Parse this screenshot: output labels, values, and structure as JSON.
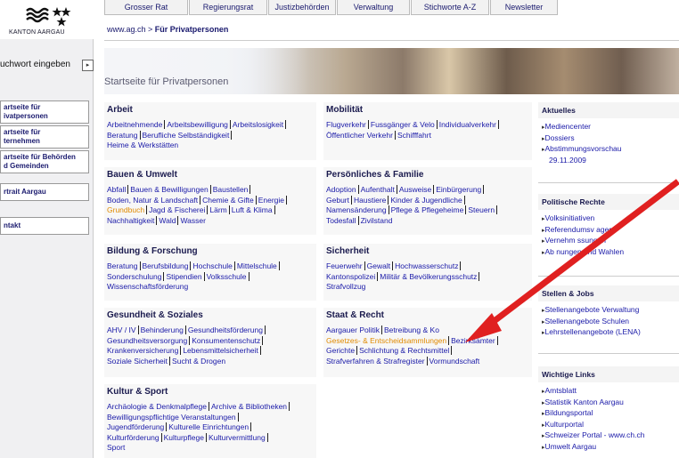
{
  "logo_text": "KANTON AARGAU",
  "topnav": [
    "Grosser Rat",
    "Regierungsrat",
    "Justizbehörden",
    "Verwaltung",
    "Stichworte A-Z",
    "Newsletter"
  ],
  "breadcrumb": {
    "site": "www.ag.ch",
    "sep": " > ",
    "page": "Für Privatpersonen"
  },
  "banner_title": "Startseite für Privatpersonen",
  "search": {
    "label": "uchwort eingeben",
    "button": "▸"
  },
  "leftnav": [
    {
      "line1": "artseite für",
      "line2": "ivatpersonen"
    },
    {
      "line1": "artseite für",
      "line2": "ternehmen"
    },
    {
      "line1": "artseite für Behörden",
      "line2": "d Gemeinden"
    },
    {
      "line1": "rtrait Aargau",
      "line2": ""
    },
    {
      "line1": "ntakt",
      "line2": ""
    }
  ],
  "sections": {
    "arbeit": {
      "title": "Arbeit",
      "links": [
        "Arbeitnehmende",
        "Arbeitsbewilligung",
        "Arbeitslosigkeit",
        "Beratung",
        "Berufliche Selbständigkeit",
        "Heime & Werkstätten"
      ]
    },
    "bauen": {
      "title": "Bauen & Umwelt",
      "links": [
        "Abfall",
        "Bauen & Bewilligungen",
        "Baustellen",
        "Boden, Natur & Landschaft",
        "Chemie & Gifte",
        "Energie",
        "Grundbuch",
        "Jagd & Fischerei",
        "Lärm",
        "Luft & Klima",
        "Nachhaltigkeit",
        "Wald",
        "Wasser"
      ]
    },
    "bildung": {
      "title": "Bildung & Forschung",
      "links": [
        "Beratung",
        "Berufsbildung",
        "Hochschule",
        "Mittelschule",
        "Sonderschulung",
        "Stipendien",
        "Volksschule",
        "Wissenschaftsförderung"
      ]
    },
    "gesundheit": {
      "title": "Gesundheit & Soziales",
      "links": [
        "AHV / IV",
        "Behinderung",
        "Gesundheitsförderung",
        "Gesundheitsversorgung",
        "Konsumentenschutz",
        "Krankenversicherung",
        "Lebensmittelsicherheit",
        "Soziale Sicherheit",
        "Sucht & Drogen"
      ]
    },
    "kultur": {
      "title": "Kultur & Sport",
      "links": [
        "Archäologie & Denkmalpflege",
        "Archive & Bibliotheken",
        "Bewilligungspflichtige Veranstaltungen",
        "Jugendförderung",
        "Kulturelle Einrichtungen",
        "Kulturförderung",
        "Kulturpflege",
        "Kulturvermittlung",
        "Sport"
      ]
    },
    "mobilitaet": {
      "title": "Mobilität",
      "links": [
        "Flugverkehr",
        "Fussgänger & Velo",
        "Individualverkehr",
        "Öffentlicher Verkehr",
        "Schifffahrt"
      ]
    },
    "persoenliches": {
      "title": "Persönliches & Familie",
      "links": [
        "Adoption",
        "Aufenthalt",
        "Ausweise",
        "Einbürgerung",
        "Geburt",
        "Haustiere",
        "Kinder & Jugendliche",
        "Namensänderung",
        "Pflege & Pflegeheime",
        "Steuern",
        "Todesfall",
        "Zivilstand"
      ]
    },
    "sicherheit": {
      "title": "Sicherheit",
      "links": [
        "Feuerwehr",
        "Gewalt",
        "Hochwasserschutz",
        "Kantonspolizei",
        "Militär & Bevölkerungsschutz",
        "Strafvollzug"
      ]
    },
    "staat": {
      "title": "Staat & Recht",
      "links": [
        "Aargauer Politik",
        "Betreibung & Ko",
        "Gesetzes- & Entscheidsammlungen",
        "Bezirksämter",
        "Gerichte",
        "Schlichtung & Rechtsmittel",
        "Strafverfahren & Strafregister",
        "Vormundschaft"
      ]
    }
  },
  "right": {
    "aktuelles": {
      "title": "Aktuelles",
      "items": [
        "Mediencenter",
        "Dossiers",
        "Abstimmungsvorschau",
        "29.11.2009"
      ]
    },
    "politische": {
      "title": "Politische Rechte",
      "items": [
        "Volksinitiativen",
        "Referendumsv   agen",
        "Vernehm   ssungen",
        "Ab   nungen und Wahlen"
      ]
    },
    "stellen": {
      "title": "Stellen & Jobs",
      "items": [
        "Stellenangebote Verwaltung",
        "Stellenangebote Schulen",
        "Lehrstellenangebote (LENA)"
      ]
    },
    "wichtige": {
      "title": "Wichtige Links",
      "items": [
        "Amtsblatt",
        "Statistik Kanton Aargau",
        "Bildungsportal",
        "Kulturportal",
        "Schweizer Portal - www.ch.ch",
        "Umwelt Aargau"
      ]
    }
  },
  "colors": {
    "accent_orange": "#e08a00",
    "arrow_red": "#e02020",
    "link_blue": "#1a1aa8"
  },
  "icons": [
    "aargau-wave-logo-icon",
    "stars-icon",
    "play-triangle-icon",
    "red-arrow-icon"
  ]
}
